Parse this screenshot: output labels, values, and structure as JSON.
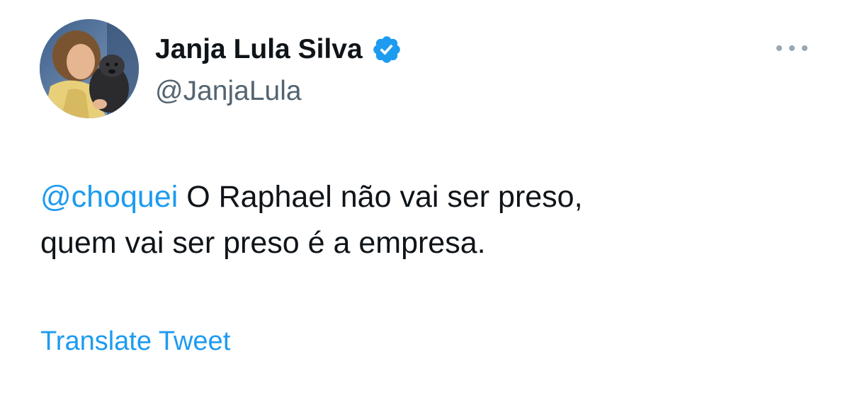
{
  "author": {
    "display_name": "Janja Lula Silva",
    "handle": "@JanjaLula",
    "verified": true,
    "avatar_icon": "profile-photo"
  },
  "tweet": {
    "mention": "@choquei",
    "line1_rest": " O Raphael não vai ser preso,",
    "line2": "quem vai ser preso é a empresa."
  },
  "actions": {
    "more_icon": "more-horizontal-icon",
    "translate_label": "Translate Tweet"
  },
  "colors": {
    "link": "#1d9bf0",
    "text": "#0f1419",
    "secondary": "#536471",
    "verified": "#1d9bf0"
  }
}
